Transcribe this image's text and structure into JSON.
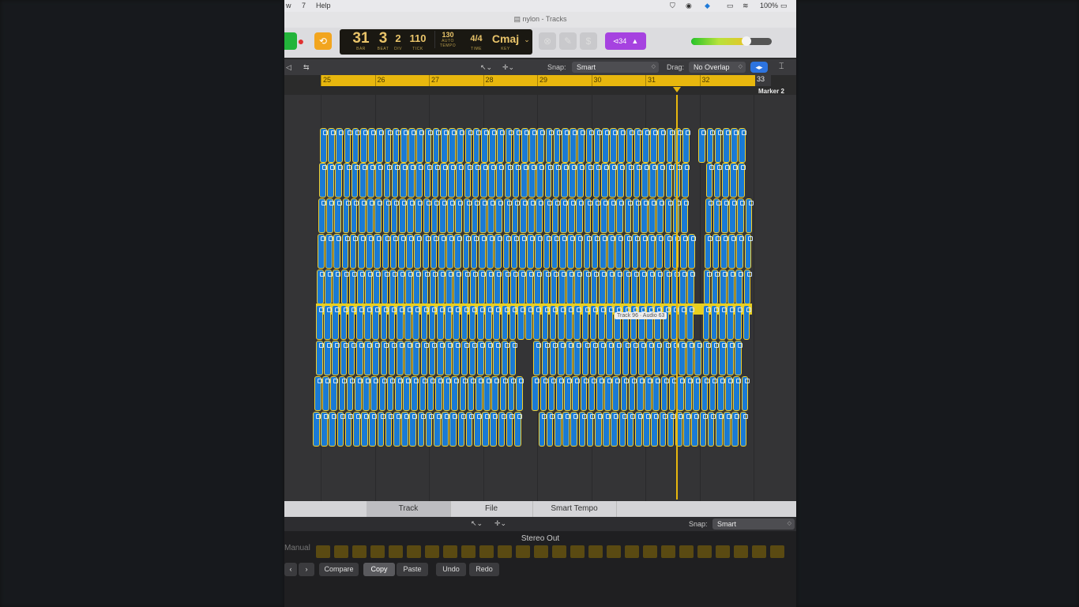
{
  "menubar": {
    "items": [
      "w",
      "7",
      "Help"
    ],
    "battery": "100%"
  },
  "window": {
    "title": "nylon - Tracks"
  },
  "lcd": {
    "bar": "31",
    "beat": "3",
    "div": "2",
    "tick": "110",
    "bar_lbl": "BAR",
    "beat_lbl": "BEAT",
    "div_lbl": "DIV",
    "tick_lbl": "TICK",
    "tempo": "130",
    "tempo_mode": "AUTO",
    "tempo_lbl": "TEMPO",
    "time_sig": "4/4",
    "time_lbl": "TIME",
    "key": "Cmaj",
    "key_lbl": "KEY"
  },
  "count_in": "⊲34",
  "master_volume_fraction": 0.69,
  "snapbar": {
    "snap_label": "Snap:",
    "snap_value": "Smart",
    "drag_label": "Drag:",
    "drag_value": "No Overlap"
  },
  "ruler": {
    "bars": [
      "25",
      "26",
      "27",
      "28",
      "29",
      "30",
      "31",
      "32"
    ],
    "end_bar": "33",
    "marker": "Marker 2"
  },
  "tooltip": "Track 96 · Audio 63",
  "editor_tabs": [
    "Track",
    "File",
    "Smart Tempo"
  ],
  "editor_snap": {
    "label": "Snap:",
    "value": "Smart"
  },
  "lower": {
    "stereo_out": "Stereo Out",
    "manual": "Manual",
    "buttons": [
      "Compare",
      "Copy",
      "Paste",
      "Undo",
      "Redo"
    ]
  },
  "colors": {
    "region": "#1a7ad4",
    "region_border": "#f2cf2e",
    "ruler": "#e8b70e",
    "count_in": "#a642e0"
  }
}
